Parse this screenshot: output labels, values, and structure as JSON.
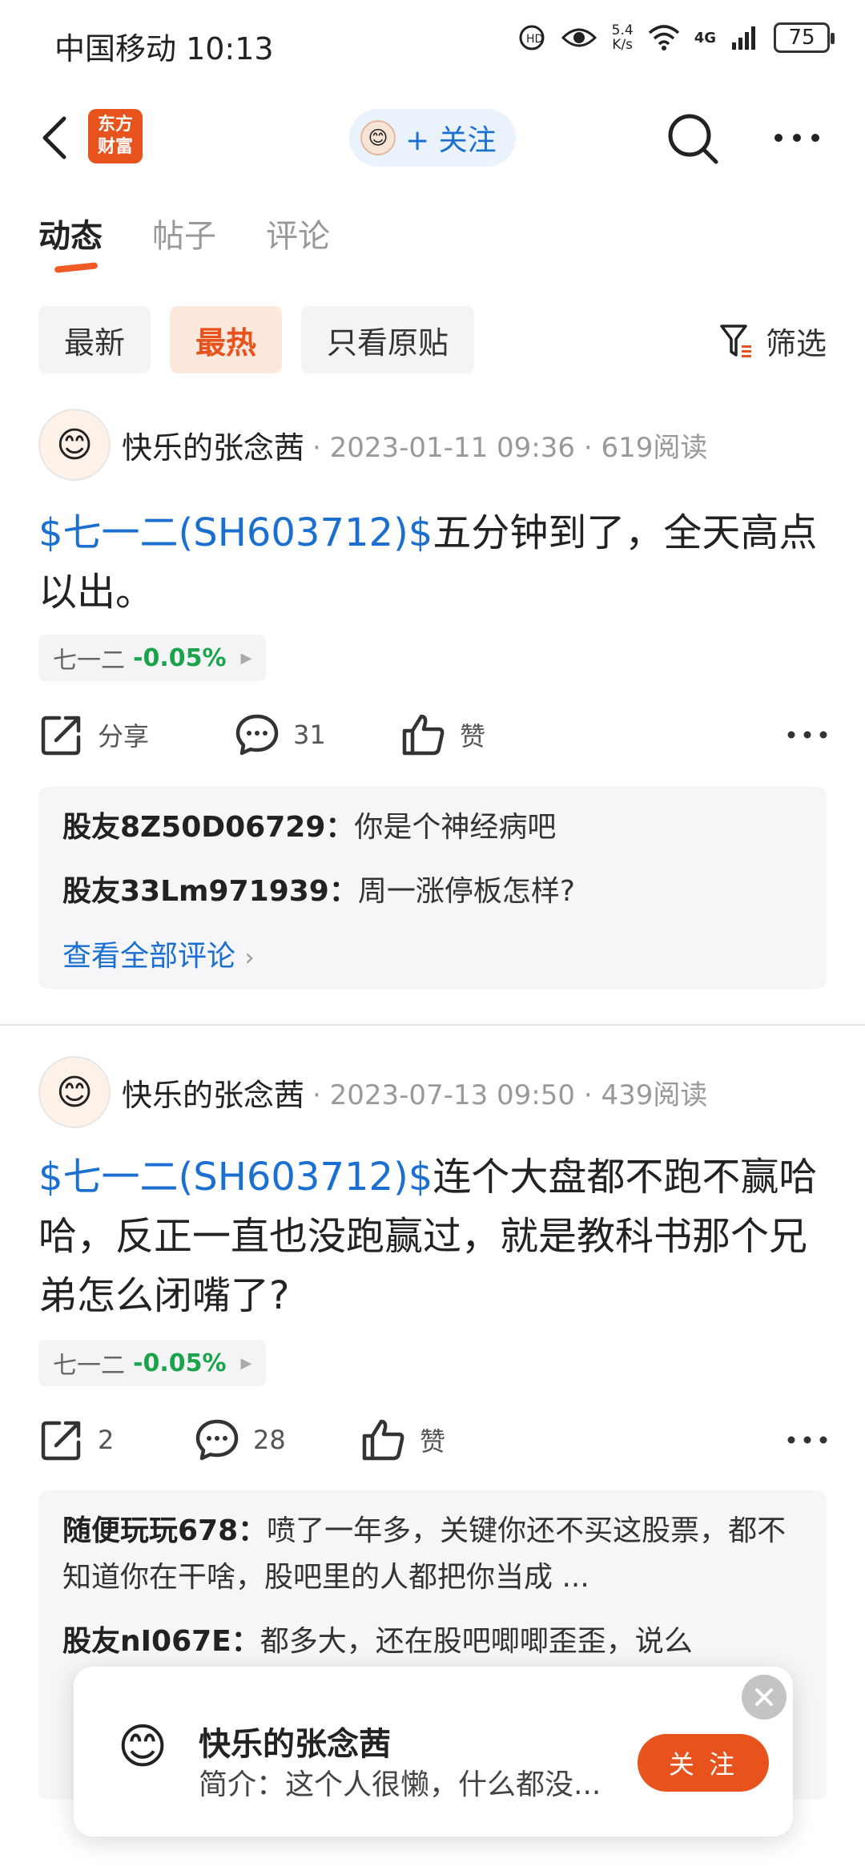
{
  "status_bar": {
    "carrier_time": "中国移动 10:13",
    "speed_top": "5.4",
    "speed_bottom": "K/s",
    "network": "4G",
    "battery": "75"
  },
  "nav": {
    "logo_line1": "东方",
    "logo_line2": "财富",
    "follow_label": "+ 关注"
  },
  "tabs": [
    {
      "label": "动态",
      "active": true
    },
    {
      "label": "帖子",
      "active": false
    },
    {
      "label": "评论",
      "active": false
    }
  ],
  "filters": {
    "chips": [
      {
        "label": "最新",
        "active": false
      },
      {
        "label": "最热",
        "active": true
      },
      {
        "label": "只看原贴",
        "active": false
      }
    ],
    "filter_label": "筛选"
  },
  "posts": [
    {
      "author": "快乐的张念茜",
      "date": "2023-01-11 09:36",
      "reads": "619阅读",
      "tag": "$七一二(SH603712)$",
      "text": "五分钟到了，全天高点以出。",
      "stock_name": "七一二",
      "stock_change": "-0.05%",
      "share": "分享",
      "comment_count": "31",
      "like": "赞",
      "comments": [
        {
          "name": "股友8Z50D06729：",
          "text": "你是个神经病吧"
        },
        {
          "name": "股友33Lm971939：",
          "text": "周一涨停板怎样?"
        }
      ],
      "view_all": "查看全部评论"
    },
    {
      "author": "快乐的张念茜",
      "date": "2023-07-13 09:50",
      "reads": "439阅读",
      "tag": "$七一二(SH603712)$",
      "text": "连个大盘都不跑不赢哈哈，反正一直也没跑赢过，就是教科书那个兄弟怎么闭嘴了?",
      "stock_name": "七一二",
      "stock_change": "-0.05%",
      "share": "2",
      "comment_count": "28",
      "like": "赞",
      "comments": [
        {
          "name": "随便玩玩678：",
          "text": "喷了一年多，关键你还不买这股票，都不知道你在干啥，股吧里的人都把你当成 ..."
        },
        {
          "name": "股友nI067E：",
          "text": "都多大，还在股吧唧唧歪歪，说么"
        }
      ]
    }
  ],
  "popup": {
    "name": "快乐的张念茜",
    "desc": "简介：这个人很懒，什么都没...",
    "follow": "关 注"
  },
  "colors": {
    "accent": "#e8531d",
    "link": "#1a6fd1",
    "positive_green": "#1aa34a"
  }
}
